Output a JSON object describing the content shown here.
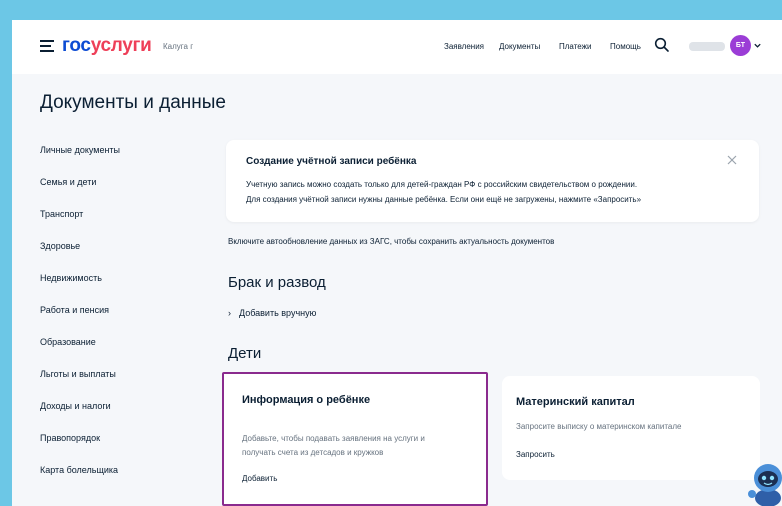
{
  "header": {
    "logo_part1": "гос",
    "logo_part2": "услуги",
    "region": "Калуга г",
    "nav": [
      "Заявления",
      "Документы",
      "Платежи",
      "Помощь"
    ],
    "avatar_initials": "БТ"
  },
  "page_title": "Документы и данные",
  "sidebar": {
    "items": [
      "Личные документы",
      "Семья и дети",
      "Транспорт",
      "Здоровье",
      "Недвижимость",
      "Работа и пенсия",
      "Образование",
      "Льготы и выплаты",
      "Доходы и налоги",
      "Правопорядок",
      "Карта болельщика"
    ]
  },
  "notice": {
    "title": "Создание учётной записи ребёнка",
    "line1": "Учетную запись можно создать только для детей-граждан РФ с российским свидетельством о рождении.",
    "line2": "Для создания учётной записи нужны данные ребёнка. Если они ещё не загружены, нажмите «Запросить»"
  },
  "auto_update_text": "Включите автообновление данных из ЗАГС, чтобы сохранить актуальность документов",
  "marriage": {
    "title": "Брак и развод",
    "add_manual": "Добавить вручную"
  },
  "children": {
    "title": "Дети",
    "child_card": {
      "title": "Информация о ребёнке",
      "text1": "Добавьте, чтобы подавать заявления на услуги и",
      "text2": "получать счета из детсадов и кружков",
      "link": "Добавить"
    },
    "capital_card": {
      "title": "Материнский капитал",
      "text": "Запросите выписку о материнском капитале",
      "link": "Запросить"
    }
  },
  "colors": {
    "brand_blue": "#0d4cd3",
    "brand_red": "#ee3f58",
    "avatar": "#9b3dd6",
    "highlight_border": "#8a2a8e"
  }
}
